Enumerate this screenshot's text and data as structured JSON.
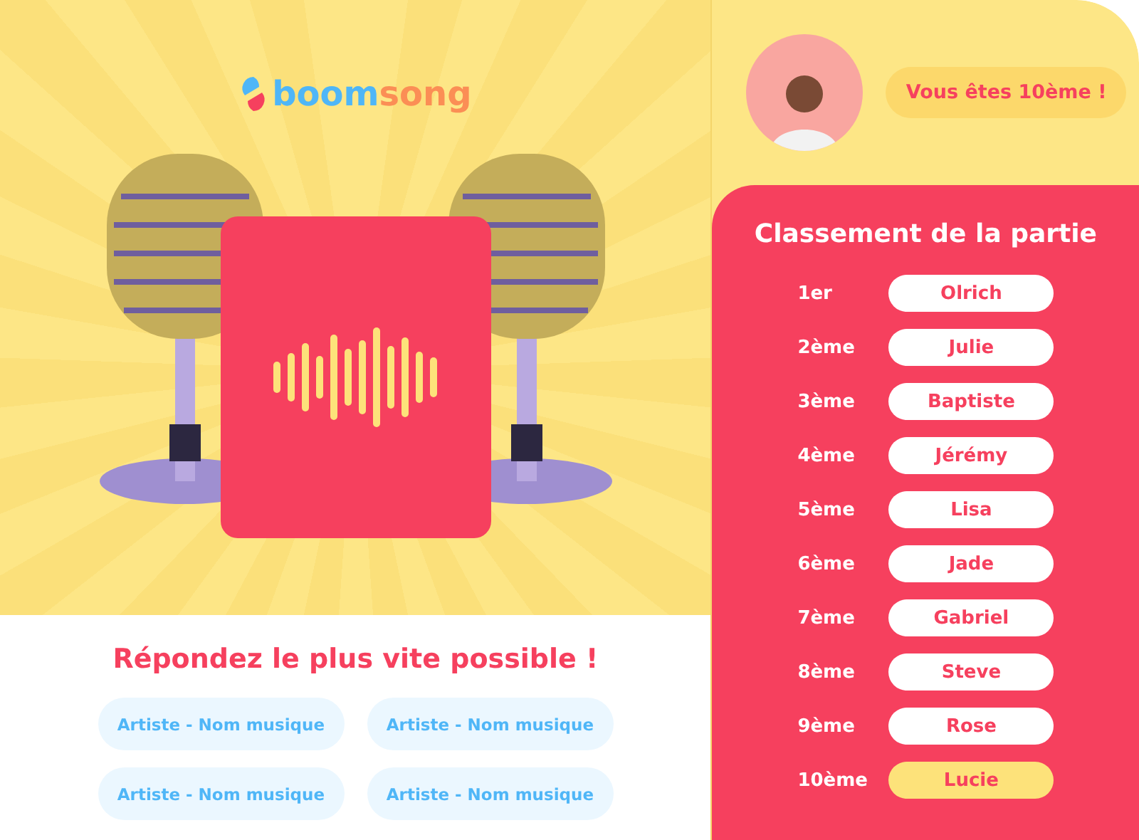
{
  "logo": {
    "part_1": "boom",
    "part_2": "song"
  },
  "prompt": "Répondez le plus vite possible !",
  "answers": [
    "Artiste - Nom musique",
    "Artiste - Nom musique",
    "Artiste - Nom musique",
    "Artiste - Nom musique"
  ],
  "player": {
    "rank_badge": "Vous êtes 10ème !"
  },
  "leaderboard": {
    "title": "Classement de la partie",
    "rows": [
      {
        "rank": "1er",
        "name": "Olrich",
        "current": false
      },
      {
        "rank": "2ème",
        "name": "Julie",
        "current": false
      },
      {
        "rank": "3ème",
        "name": "Baptiste",
        "current": false
      },
      {
        "rank": "4ème",
        "name": "Jérémy",
        "current": false
      },
      {
        "rank": "5ème",
        "name": "Lisa",
        "current": false
      },
      {
        "rank": "6ème",
        "name": "Jade",
        "current": false
      },
      {
        "rank": "7ème",
        "name": "Gabriel",
        "current": false
      },
      {
        "rank": "8ème",
        "name": "Steve",
        "current": false
      },
      {
        "rank": "9ème",
        "name": "Rose",
        "current": false
      },
      {
        "rank": "10ème",
        "name": "Lucie",
        "current": true
      }
    ]
  }
}
